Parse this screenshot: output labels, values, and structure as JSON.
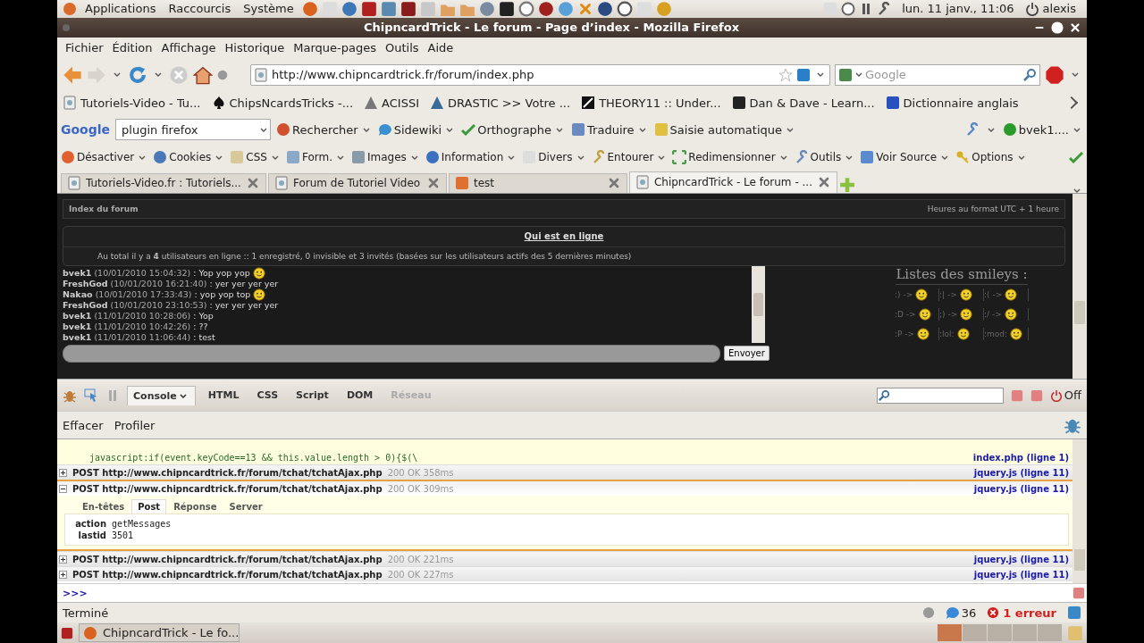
{
  "top_panel": {
    "menus": [
      "Applications",
      "Raccourcis",
      "Système"
    ],
    "clock": "lun. 11 janv., 11:06",
    "user": "alexis"
  },
  "window": {
    "title": "ChipncardTrick - Le forum - Page d’index - Mozilla Firefox"
  },
  "menu_bar": [
    "Fichier",
    "Édition",
    "Affichage",
    "Historique",
    "Marque-pages",
    "Outils",
    "Aide"
  ],
  "address_bar": {
    "value": "http://www.chipncardtrick.fr/forum/index.php"
  },
  "search": {
    "placeholder": "Google"
  },
  "bookmarks": [
    "Tutoriels-Video - Tu...",
    "ChipsNcardsTricks -...",
    "ACISSI",
    "DRASTIC >> Votre ...",
    "THEORY11 :: Under...",
    "Dan & Dave - Learn...",
    "Dictionnaire anglais"
  ],
  "google_toolbar": {
    "logo": "Google",
    "query": "plugin firefox",
    "buttons": [
      "Rechercher",
      "Sidewiki",
      "Orthographe",
      "Traduire",
      "Saisie automatique"
    ],
    "account": "bvek1...."
  },
  "webdev_toolbar": [
    "Désactiver",
    "Cookies",
    "CSS",
    "Form.",
    "Images",
    "Information",
    "Divers",
    "Entourer",
    "Redimensionner",
    "Outils",
    "Voir Source",
    "Options"
  ],
  "tabs": [
    {
      "label": "Tutoriels-Video.fr : Tutoriels...",
      "selected": false
    },
    {
      "label": "Forum de Tutoriel Video",
      "selected": false
    },
    {
      "label": "test",
      "selected": false
    },
    {
      "label": "ChipncardTrick - Le forum - ...",
      "selected": true
    }
  ],
  "page": {
    "breadcrumb": "Index du forum",
    "timezone": "Heures au format UTC + 1 heure",
    "online_title": "Qui est en ligne",
    "online_text": "Au total il y a **4** utilisateurs en ligne :: 1 enregistré, 0 invisible et 3 invités (basées sur les utilisateurs actifs des 5 dernières minutes)",
    "chat": [
      {
        "user": "bvek1",
        "time": "(10/01/2010 15:04:32)",
        "text": ": Yop yop yop",
        "smiley": true
      },
      {
        "user": "FreshGod",
        "time": "(10/01/2010 16:21:40)",
        "text": ": yer yer yer yer",
        "smiley": false
      },
      {
        "user": "Nakao",
        "time": "(10/01/2010 17:33:43)",
        "text": ": yop yop top",
        "smiley": true
      },
      {
        "user": "FreshGod",
        "time": "(10/01/2010 23:10:53)",
        "text": ": yer yer yer yer",
        "smiley": false
      },
      {
        "user": "bvek1",
        "time": "(11/01/2010 10:28:06)",
        "text": ": Yop",
        "smiley": false
      },
      {
        "user": "bvek1",
        "time": "(11/01/2010 10:42:26)",
        "text": ": ??",
        "smiley": false
      },
      {
        "user": "bvek1",
        "time": "(11/01/2010 11:06:44)",
        "text": ": test",
        "smiley": false
      }
    ],
    "send_button": "Envoyer",
    "smileys": {
      "title": "Listes des smileys :",
      "codes": [
        ":) ->",
        ":| ->",
        ":( ->",
        ":D ->",
        ";) ->",
        ":/ ->",
        ":P ->",
        ":lol:",
        ":mod:"
      ]
    }
  },
  "firebug": {
    "tabs": [
      {
        "label": "Console",
        "selected": true,
        "disabled": false
      },
      {
        "label": "HTML",
        "selected": false,
        "disabled": false
      },
      {
        "label": "CSS",
        "selected": false,
        "disabled": false
      },
      {
        "label": "Script",
        "selected": false,
        "disabled": false
      },
      {
        "label": "DOM",
        "selected": false,
        "disabled": false
      },
      {
        "label": "Réseau",
        "selected": false,
        "disabled": true
      }
    ],
    "off_label": "Off",
    "actions": [
      "Effacer",
      "Profiler"
    ],
    "error": {
      "code": "javascript:if(event.keyCode==13 && this.value.length > 0){$(\\",
      "source": "index.php (ligne 1)"
    },
    "requests": [
      {
        "request": "POST http://www.chipncardtrick.fr/forum/tchat/tchatAjax.php",
        "status": "200 OK 358ms",
        "source": "jquery.js (ligne 11)",
        "expanded": false
      },
      {
        "request": "POST http://www.chipncardtrick.fr/forum/tchat/tchatAjax.php",
        "status": "200 OK 309ms",
        "source": "jquery.js (ligne 11)",
        "expanded": true
      },
      {
        "request": "POST http://www.chipncardtrick.fr/forum/tchat/tchatAjax.php",
        "status": "200 OK 221ms",
        "source": "jquery.js (ligne 11)",
        "expanded": false
      },
      {
        "request": "POST http://www.chipncardtrick.fr/forum/tchat/tchatAjax.php",
        "status": "200 OK 227ms",
        "source": "jquery.js (ligne 11)",
        "expanded": false
      }
    ],
    "detail_tabs": [
      {
        "label": "En-têtes",
        "selected": false
      },
      {
        "label": "Post",
        "selected": true
      },
      {
        "label": "Réponse",
        "selected": false
      },
      {
        "label": "Server",
        "selected": false
      }
    ],
    "params": [
      {
        "name": "action",
        "value": "getMessages"
      },
      {
        "name": "lastid",
        "value": "3501"
      }
    ],
    "prompt": ">>>"
  },
  "status_bar": {
    "text": "Terminé",
    "count": "36",
    "errors": "1 erreur"
  },
  "taskbar": {
    "items": [
      "ChipncardTrick - Le fo..."
    ]
  }
}
